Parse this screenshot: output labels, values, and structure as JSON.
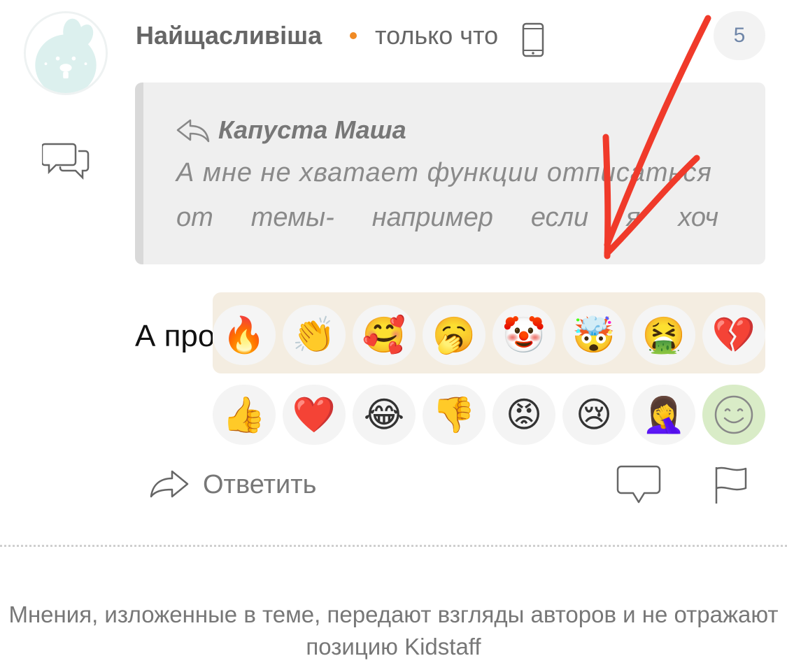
{
  "post": {
    "author": "Найщасливіша",
    "timestamp": "только что",
    "count": "5",
    "message": "А про",
    "avatar_icon": "bunny-avatar-icon",
    "device_icon": "phone-icon"
  },
  "quote": {
    "author": "Капуста Маша",
    "line1": "А мне не хватает функции отписаться",
    "line2_words": [
      "от",
      "темы-",
      "например",
      "если",
      "я",
      "хоч"
    ]
  },
  "reactions": {
    "row1": [
      {
        "name": "fire",
        "glyph": "🔥"
      },
      {
        "name": "clapping-hands",
        "glyph": "👏"
      },
      {
        "name": "smiling-face-with-hearts",
        "glyph": "🥰"
      },
      {
        "name": "yawning-face",
        "glyph": "🥱"
      },
      {
        "name": "clown-face",
        "glyph": "🤡"
      },
      {
        "name": "exploding-head",
        "glyph": "🤯"
      },
      {
        "name": "vomiting-face",
        "glyph": "🤮"
      },
      {
        "name": "broken-heart",
        "glyph": "💔"
      }
    ],
    "row2": [
      {
        "name": "thumbs-up",
        "glyph": "👍"
      },
      {
        "name": "red-heart",
        "glyph": "❤️"
      },
      {
        "name": "tears-of-joy",
        "glyph": "😂"
      },
      {
        "name": "thumbs-down",
        "glyph": "👎"
      },
      {
        "name": "angry-face",
        "glyph": "😡"
      },
      {
        "name": "crying-face",
        "glyph": "😢"
      },
      {
        "name": "facepalm",
        "glyph": "🤦‍♀️"
      }
    ],
    "picker_toggle_icon": "smiley-icon"
  },
  "actions": {
    "reply_label": "Ответить",
    "comment_icon": "comment-icon",
    "flag_icon": "flag-icon"
  },
  "footer": {
    "disclaimer": "Мнения, изложенные в теме, передают взгляды авторов и не отражают позицию Kidstaff"
  },
  "colors": {
    "accent_dot": "#f08a24",
    "count_text": "#6f86a8",
    "reaction_panel_bg": "#f4ede1",
    "smiley_active_bg": "#d9ecc7",
    "annotation_arrow": "#f03a2a"
  }
}
